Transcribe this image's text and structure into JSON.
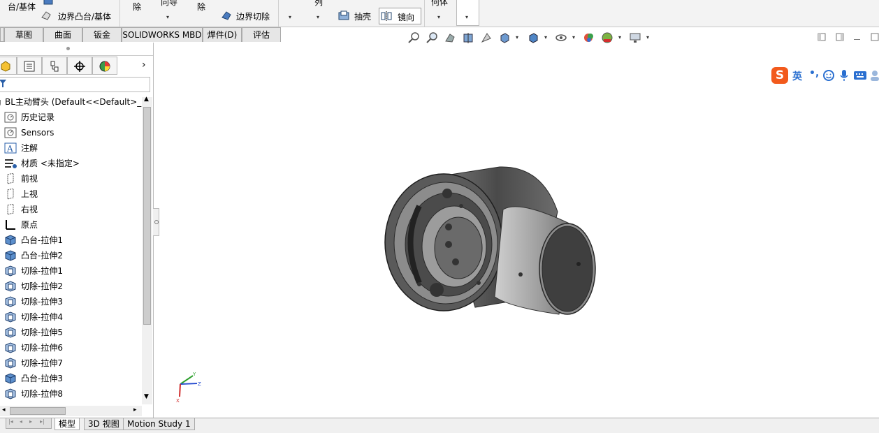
{
  "ribbon": {
    "items": [
      {
        "label": "台/基体"
      },
      {
        "label": "边界凸台/基体"
      },
      {
        "label": "除"
      },
      {
        "label": "向导"
      },
      {
        "label": "除"
      },
      {
        "label": "边界切除"
      },
      {
        "label": "列"
      },
      {
        "label": "抽壳"
      },
      {
        "label": "镜向"
      },
      {
        "label": "何体"
      }
    ]
  },
  "command_tabs": [
    "草图",
    "曲面",
    "钣金",
    "SOLIDWORKS MBD",
    "焊件(D)",
    "评估"
  ],
  "feature_tree": {
    "root": "BL主动臂头  (Default<<Default>_P",
    "items": [
      {
        "label": "历史记录",
        "icon": "history-icon"
      },
      {
        "label": "Sensors",
        "icon": "sensor-icon"
      },
      {
        "label": "注解",
        "icon": "annotation-icon"
      },
      {
        "label": "材质 <未指定>",
        "icon": "material-icon"
      },
      {
        "label": "前视",
        "icon": "plane-icon"
      },
      {
        "label": "上视",
        "icon": "plane-icon"
      },
      {
        "label": "右视",
        "icon": "plane-icon"
      },
      {
        "label": "原点",
        "icon": "origin-icon"
      },
      {
        "label": "凸台-拉伸1",
        "icon": "boss-extrude-icon"
      },
      {
        "label": "凸台-拉伸2",
        "icon": "boss-extrude-icon"
      },
      {
        "label": "切除-拉伸1",
        "icon": "cut-extrude-icon"
      },
      {
        "label": "切除-拉伸2",
        "icon": "cut-extrude-icon"
      },
      {
        "label": "切除-拉伸3",
        "icon": "cut-extrude-icon"
      },
      {
        "label": "切除-拉伸4",
        "icon": "cut-extrude-icon"
      },
      {
        "label": "切除-拉伸5",
        "icon": "cut-extrude-icon"
      },
      {
        "label": "切除-拉伸6",
        "icon": "cut-extrude-icon"
      },
      {
        "label": "切除-拉伸7",
        "icon": "cut-extrude-icon"
      },
      {
        "label": "凸台-拉伸3",
        "icon": "boss-extrude-icon"
      },
      {
        "label": "切除-拉伸8",
        "icon": "cut-extrude-icon"
      }
    ]
  },
  "bottom_tabs": [
    "模型",
    "3D 视图",
    "Motion Study 1"
  ],
  "triad": {
    "x": "X",
    "y": "Y",
    "z": "Z"
  },
  "ime": {
    "label": "英"
  },
  "colors": {
    "ribbon_bg": "#f3f3f3",
    "model_body": "#5a5a5a",
    "accent": "#0060c0"
  }
}
